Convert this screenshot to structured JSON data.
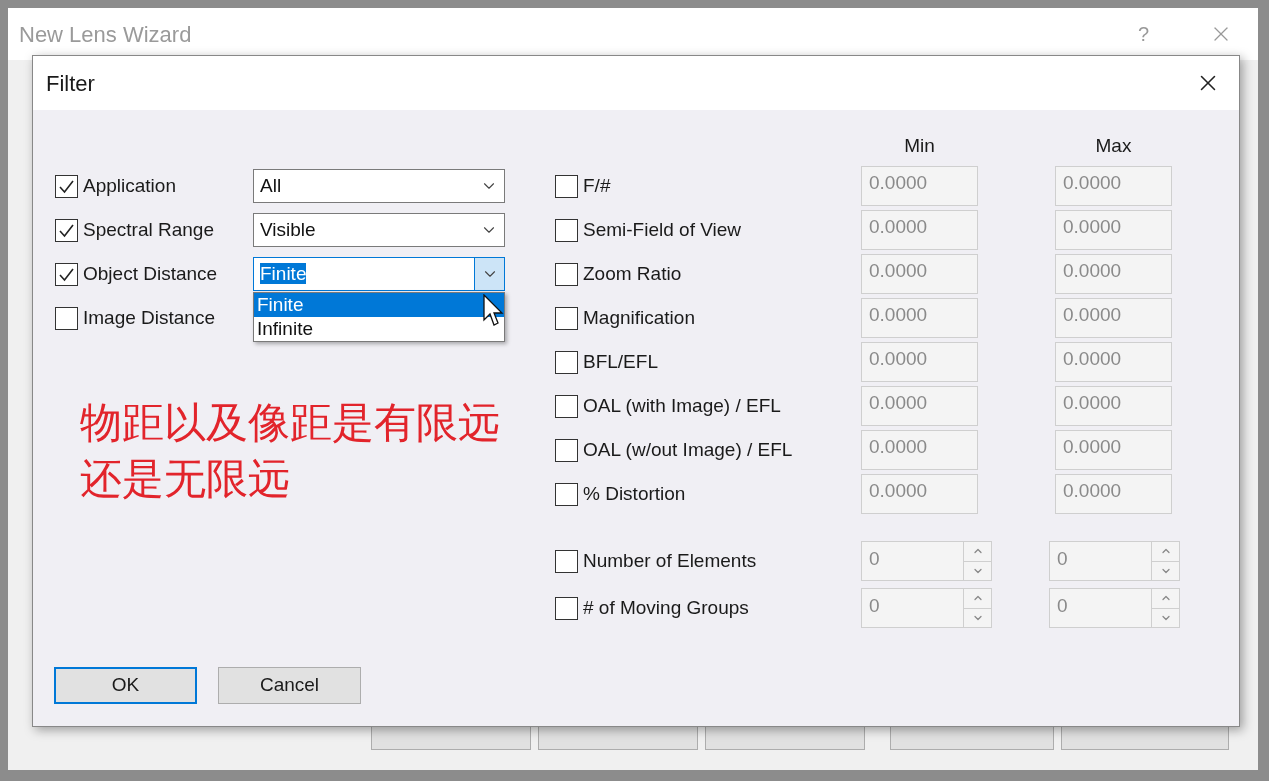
{
  "wizard": {
    "title": "New Lens Wizard",
    "help": "?"
  },
  "filter": {
    "title": "Filter",
    "left_rows": [
      {
        "label": "Application",
        "checked": true,
        "value": "All",
        "open": false
      },
      {
        "label": "Spectral Range",
        "checked": true,
        "value": "Visible",
        "open": false
      },
      {
        "label": "Object Distance",
        "checked": true,
        "value": "Finite",
        "open": true,
        "options": [
          {
            "label": "Finite",
            "selected": true
          },
          {
            "label": "Infinite",
            "selected": false
          }
        ]
      },
      {
        "label": "Image Distance",
        "checked": false
      }
    ],
    "headers": {
      "min": "Min",
      "max": "Max"
    },
    "range_rows": [
      {
        "kind": "decimal",
        "label": "F/#",
        "checked": false,
        "min": "0.0000",
        "max": "0.0000"
      },
      {
        "kind": "decimal",
        "label": "Semi-Field of View",
        "checked": false,
        "min": "0.0000",
        "max": "0.0000"
      },
      {
        "kind": "decimal",
        "label": "Zoom Ratio",
        "checked": false,
        "min": "0.0000",
        "max": "0.0000"
      },
      {
        "kind": "decimal",
        "label": "Magnification",
        "checked": false,
        "min": "0.0000",
        "max": "0.0000"
      },
      {
        "kind": "decimal",
        "label": "BFL/EFL",
        "checked": false,
        "min": "0.0000",
        "max": "0.0000"
      },
      {
        "kind": "decimal",
        "label": "OAL (with Image) / EFL",
        "checked": false,
        "min": "0.0000",
        "max": "0.0000"
      },
      {
        "kind": "decimal",
        "label": "OAL (w/out Image) / EFL",
        "checked": false,
        "min": "0.0000",
        "max": "0.0000"
      },
      {
        "kind": "decimal",
        "label": "% Distortion",
        "checked": false,
        "min": "0.0000",
        "max": "0.0000"
      },
      {
        "kind": "spin",
        "label": "Number of Elements",
        "checked": false,
        "min": "0",
        "max": "0"
      },
      {
        "kind": "spin",
        "label": "# of Moving Groups",
        "checked": false,
        "min": "0",
        "max": "0"
      }
    ],
    "buttons": [
      {
        "label": "OK",
        "default": true
      },
      {
        "label": "Cancel",
        "default": false
      }
    ]
  },
  "subtitle": "物距以及像距是有限远还是无限远"
}
